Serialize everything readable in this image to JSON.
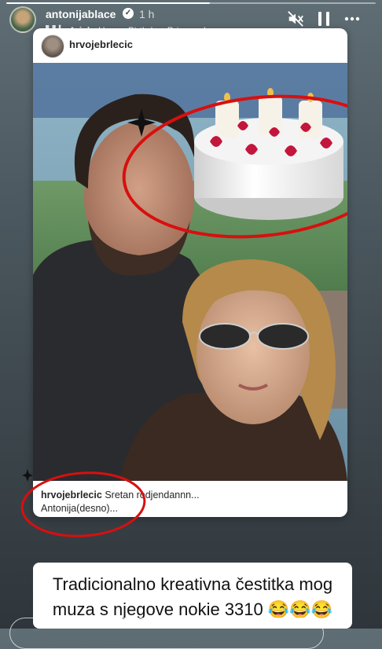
{
  "story": {
    "progress": 0.55,
    "username": "antonijablace",
    "verified_icon": "verified-badge-icon",
    "time": "1 h",
    "music": {
      "icon": "music-bars-icon",
      "artist": "Ariel",
      "separator": " · ",
      "title": "Happy Birthday, Princess!"
    },
    "icons": {
      "mute": "mute-icon",
      "pause": "pause-icon",
      "more": "more-icon"
    }
  },
  "post": {
    "username": "hrvojebrlecic",
    "caption_user": "hrvojebrlecic",
    "caption_text": "Sretan rodjendannn...",
    "caption_line2": "Antonija(desno)..."
  },
  "overlay": {
    "text": "Tradicionalno kreativna čestitka mog muza s njegove nokie 3310 😂😂😂",
    "line1": "Tradicionalno kreativna čestitka mog",
    "line2": "muza s njegove nokie 3310 😂😂😂",
    "annotation_color": "#d80f0f"
  }
}
